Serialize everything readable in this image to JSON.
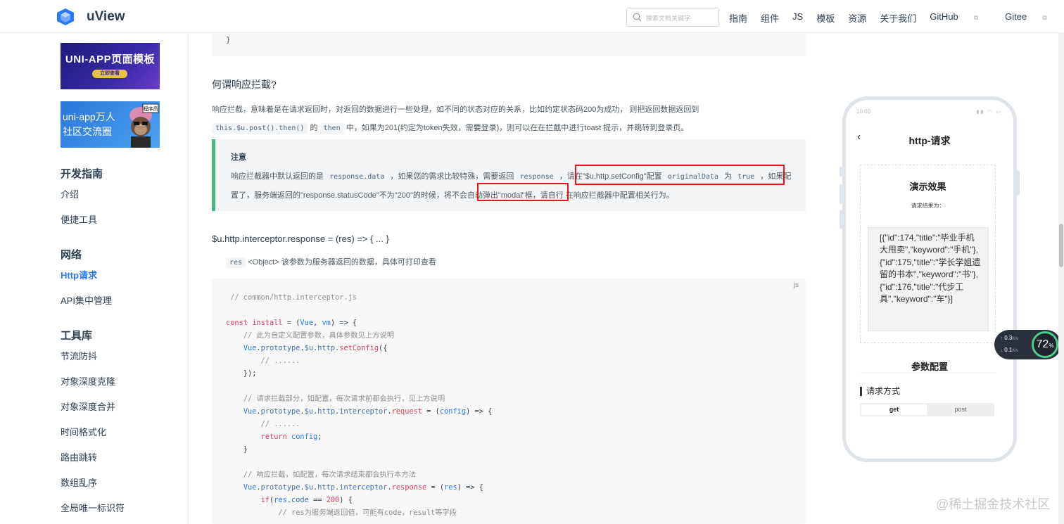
{
  "header": {
    "brand": "uView",
    "search_placeholder": "搜索文档关键字",
    "nav": [
      "指南",
      "组件",
      "JS",
      "模板",
      "资源",
      "关于我们",
      "GitHub",
      "Gitee"
    ]
  },
  "sidebar": {
    "banner1_title": "UNI-APP页面模板",
    "banner1_button": "立即查看",
    "banner2_title_line1": "uni-app万人",
    "banner2_title_line2": "社区交流圈",
    "banner2_tag": "程序员",
    "groups": [
      {
        "title": "开发指南",
        "items": [
          "介绍",
          "便捷工具"
        ]
      },
      {
        "title": "网络",
        "items": [
          "Http请求",
          "API集中管理"
        ]
      },
      {
        "title": "工具库",
        "items": [
          "节流防抖",
          "对象深度克隆",
          "对象深度合并",
          "时间格式化",
          "路由跳转",
          "数组乱序",
          "全局唯一标识符"
        ]
      }
    ]
  },
  "content": {
    "code_top_brace": "}",
    "section_title": "何谓响应拦截?",
    "p1_a": "响应拦截，意味着是在请求返回时，对返回的数据进行一些处理，如不同的状态对应的关系，比如约定状态码200为成功， 则把返回数据返回到",
    "p1_code1": "this.$u.post().then()",
    "p1_b": "的",
    "p1_code2": "then",
    "p1_c": "中，如果为201(约定为token失效，需要登录)，则可以在在拦截中进行toast 提示，并跳转到登录页。",
    "tip_title": "注意",
    "tip_a": "响应拦截器中默认返回的是",
    "tip_code1": "response.data",
    "tip_b": "，如果您的需求比较特殊，需要返回",
    "tip_code2": "response",
    "tip_c": "，请在\"$u.http.setConfig\"配置",
    "tip_code3": "originalData",
    "tip_d": "为",
    "tip_code4": "true",
    "tip_e": "，如果配置了，服务端返回的\"response.statusCode\"不为\"200\"的时候，将不会自动弹出\"modal\"框，请自行 在响应拦截器中配置相关行为。",
    "api_title": "$u.http.interceptor.response = (res) => { ... }",
    "res_code": "res",
    "res_desc": "<Object> 该参数为服务器返回的数据，具体可打印查看",
    "code_lang": "js"
  },
  "phone": {
    "time": "10:00",
    "title": "http-请求",
    "demo_title": "演示效果",
    "demo_sub": "请求结果为：",
    "result": "[{\"id\":174,\"title\":\"毕业手机大甩卖\",\"keyword\":\"手机\"},{\"id\":175,\"title\":\"学长学姐遗留的书本\",\"keyword\":\"书\"},{\"id\":176,\"title\":\"代步工具\",\"keyword\":\"车\"}]",
    "param_title": "参数配置",
    "method_label": "请求方式",
    "tab_get": "get",
    "tab_post": "post"
  },
  "net_widget": {
    "up": "0.3",
    "down": "0.1",
    "unit": "K/s",
    "percent": "72"
  },
  "watermark": "@稀土掘金技术社区"
}
